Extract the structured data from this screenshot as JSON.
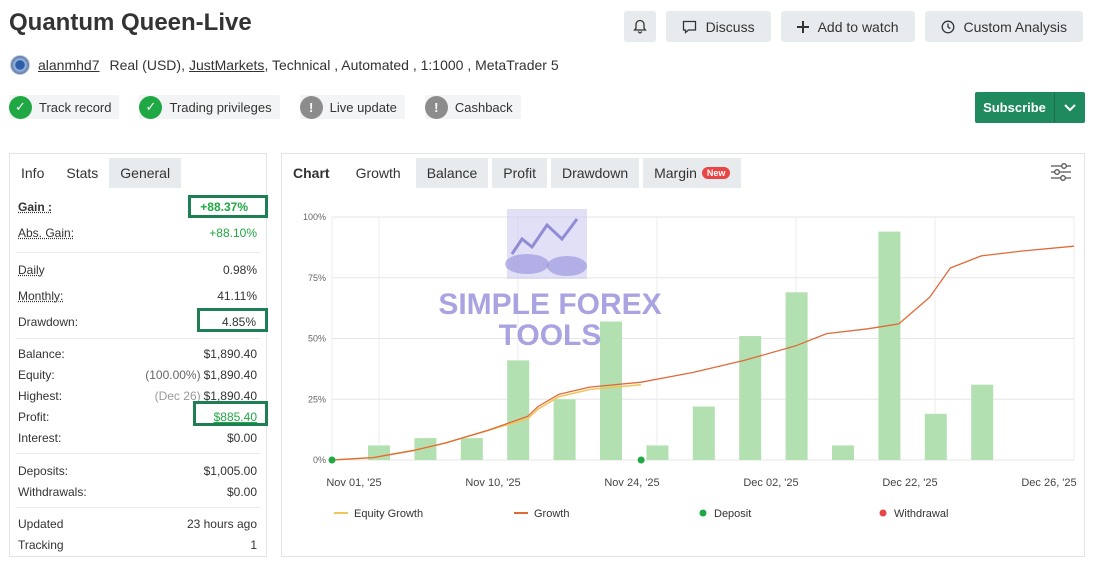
{
  "header": {
    "title": "Quantum Queen-Live",
    "buttons": {
      "discuss": "Discuss",
      "add_to_watch": "Add to watch",
      "custom_analysis": "Custom Analysis"
    }
  },
  "account": {
    "user": "alanmhd7",
    "type": "Real (USD),",
    "broker": "JustMarkets",
    "details": ", Technical , Automated , 1:1000 , MetaTrader 5"
  },
  "badges": [
    {
      "label": "Track record",
      "status": "ok"
    },
    {
      "label": "Trading privileges",
      "status": "ok"
    },
    {
      "label": "Live update",
      "status": "warn"
    },
    {
      "label": "Cashback",
      "status": "warn"
    }
  ],
  "subscribe": {
    "label": "Subscribe"
  },
  "left_tabs": [
    "Info",
    "Stats",
    "General"
  ],
  "stats": {
    "gain": {
      "label": "Gain :",
      "value": "+88.37%"
    },
    "abs_gain": {
      "label": "Abs. Gain:",
      "value": "+88.10%"
    },
    "daily": {
      "label": "Daily",
      "value": "0.98%"
    },
    "monthly": {
      "label": "Monthly:",
      "value": "41.11%"
    },
    "drawdown": {
      "label": "Drawdown:",
      "value": "4.85%"
    },
    "balance": {
      "label": "Balance:",
      "value": "$1,890.40"
    },
    "equity": {
      "label": "Equity:",
      "prefix": "(100.00%)",
      "value": "$1,890.40"
    },
    "highest": {
      "label": "Highest:",
      "prefix": "(Dec 26)",
      "value": "$1,890.40"
    },
    "profit": {
      "label": "Profit:",
      "value": "$885.40"
    },
    "interest": {
      "label": "Interest:",
      "value": "$0.00"
    },
    "deposits": {
      "label": "Deposits:",
      "value": "$1,005.00"
    },
    "withdrawals": {
      "label": "Withdrawals:",
      "value": "$0.00"
    },
    "updated": {
      "label": "Updated",
      "value": "23 hours ago"
    },
    "tracking": {
      "label": "Tracking",
      "value": "1"
    }
  },
  "chart_tabs": {
    "chart": "Chart",
    "growth": "Growth",
    "balance": "Balance",
    "profit": "Profit",
    "drawdown": "Drawdown",
    "margin": "Margin",
    "new_badge": "New"
  },
  "watermark": {
    "line1": "SIMPLE FOREX",
    "line2": "TOOLS"
  },
  "colors": {
    "accent": "#1e8a5e",
    "bar": "#b3e0b0",
    "growth": "#e06a3a",
    "equity": "#f0c75e",
    "deposit": "#1fa843",
    "withdrawal": "#e84545"
  },
  "chart_data": {
    "type": "bar",
    "y_ticks": [
      "100%",
      "75%",
      "50%",
      "25%",
      "0%"
    ],
    "ylim": [
      0,
      100
    ],
    "x_ticks": [
      "Nov 01, '25",
      "Nov 10, '25",
      "Nov 24, '25",
      "Dec 02, '25",
      "Dec 22, '25",
      "Dec 26, '25"
    ],
    "bars": [
      6,
      9,
      9,
      41,
      25,
      57,
      6,
      22,
      51,
      69,
      6,
      94,
      19,
      31
    ],
    "growth": [
      [
        0,
        0
      ],
      [
        4,
        1
      ],
      [
        8,
        4
      ],
      [
        11,
        7
      ],
      [
        15,
        12
      ],
      [
        19,
        18
      ],
      [
        20,
        22
      ],
      [
        22,
        27
      ],
      [
        25,
        30
      ],
      [
        30,
        32
      ],
      [
        35,
        36
      ],
      [
        40,
        41
      ],
      [
        45,
        47
      ],
      [
        48,
        52
      ],
      [
        52,
        54
      ],
      [
        55,
        56
      ],
      [
        58,
        67
      ],
      [
        60,
        79
      ],
      [
        63,
        84
      ],
      [
        67,
        86
      ],
      [
        72,
        88
      ]
    ],
    "equity": [
      [
        0,
        0
      ],
      [
        4,
        1
      ],
      [
        8,
        4
      ],
      [
        11,
        7
      ],
      [
        15,
        12
      ],
      [
        19,
        17
      ],
      [
        20,
        21
      ],
      [
        22,
        26
      ],
      [
        25,
        29
      ],
      [
        30,
        31
      ]
    ],
    "deposits_x": [
      0,
      30
    ],
    "legend": [
      "Equity Growth",
      "Growth",
      "Deposit",
      "Withdrawal"
    ]
  }
}
